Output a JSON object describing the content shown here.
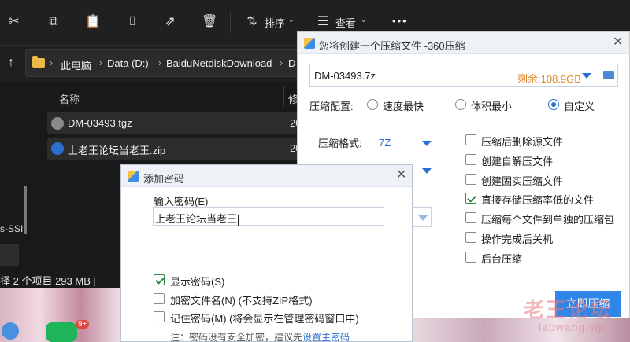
{
  "explorer": {
    "toolbar": {
      "sort_label": "排序",
      "view_label": "查看",
      "more_label": "•••"
    },
    "breadcrumb": [
      "此电脑",
      "Data (D:)",
      "BaiduNetdiskDownload",
      "D"
    ],
    "column_name": "名称",
    "column_modified": "修",
    "files": [
      {
        "name": "DM-03493.tgz",
        "col2": "20",
        "icon_color": "#8a8a8a"
      },
      {
        "name": "上老王论坛当老王.zip",
        "col2": "20",
        "icon_color": "#2d6fd0"
      }
    ],
    "side_fragment": "s-SSI",
    "status": "择 2 个项目  293 MB  |"
  },
  "compressor": {
    "title": "您将创建一个压缩文件 -360压缩",
    "path": "DM-03493.7z",
    "free_space": "剩余:108.9GB",
    "config_label": "压缩配置:",
    "radio_options": [
      {
        "label": "速度最快",
        "selected": false
      },
      {
        "label": "体积最小",
        "selected": false
      },
      {
        "label": "自定义",
        "selected": true
      }
    ],
    "format_label": "压缩格式:",
    "format_value": "7Z",
    "checkboxes": [
      {
        "label": "压缩后删除源文件",
        "checked": false
      },
      {
        "label": "创建自解压文件",
        "checked": false
      },
      {
        "label": "创建固实压缩文件",
        "checked": false
      },
      {
        "label": "直接存储压缩率低的文件",
        "checked": true
      },
      {
        "label": "压缩每个文件到单独的压缩包",
        "checked": false
      },
      {
        "label": "操作完成后关机",
        "checked": false
      },
      {
        "label": "后台压缩",
        "checked": false
      }
    ],
    "start_button": "立即压缩"
  },
  "password_dialog": {
    "title": "添加密码",
    "input_label": "输入密码(E)",
    "password_value": "上老王论坛当老王",
    "options": [
      {
        "label": "显示密码(S)",
        "checked": true
      },
      {
        "label": "加密文件名(N) (不支持ZIP格式)",
        "checked": false
      },
      {
        "label": "记住密码(M) (将会显示在管理密码窗口中)",
        "checked": false
      }
    ],
    "note_prefix": "注：密码没有安全加密，建议先",
    "note_link": "设置主密码"
  },
  "watermark": {
    "main": "老王论坛",
    "sub": "laowang.vip"
  },
  "colors": {
    "accent_blue": "#2d6fd0",
    "free_space_orange": "#e08a2a",
    "check_green": "#2d8a4a",
    "explorer_bg": "#1c1c1c"
  },
  "icons": {
    "toolbar": [
      "cut-icon",
      "copy-icon",
      "paste-icon",
      "rename-icon",
      "share-icon",
      "delete-icon",
      "sort-icon",
      "view-icon",
      "more-icon"
    ]
  }
}
